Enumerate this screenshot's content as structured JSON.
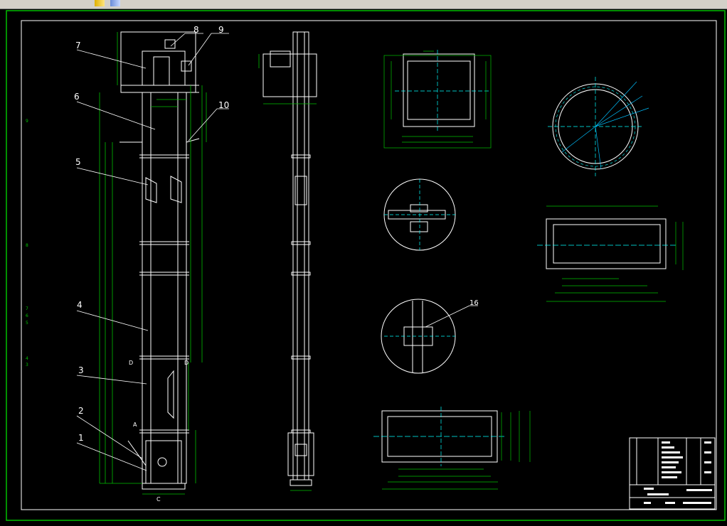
{
  "toolbar": {
    "icons": [
      "pencil-icon",
      "layers-icon"
    ]
  },
  "drawing": {
    "background": "#000000",
    "line_color": "#ffffff",
    "dimension_color": "#00ff00",
    "center_color": "#00ffff",
    "part_labels": [
      "1",
      "2",
      "3",
      "4",
      "5",
      "6",
      "7",
      "8",
      "9",
      "10"
    ],
    "detail_label_16": "16",
    "section_labels": {
      "d_left": "D",
      "d_right": "D",
      "c": "C",
      "a": "A"
    },
    "grid_refs": [
      "9",
      "8",
      "7",
      "6",
      "5",
      "4",
      "3"
    ]
  }
}
